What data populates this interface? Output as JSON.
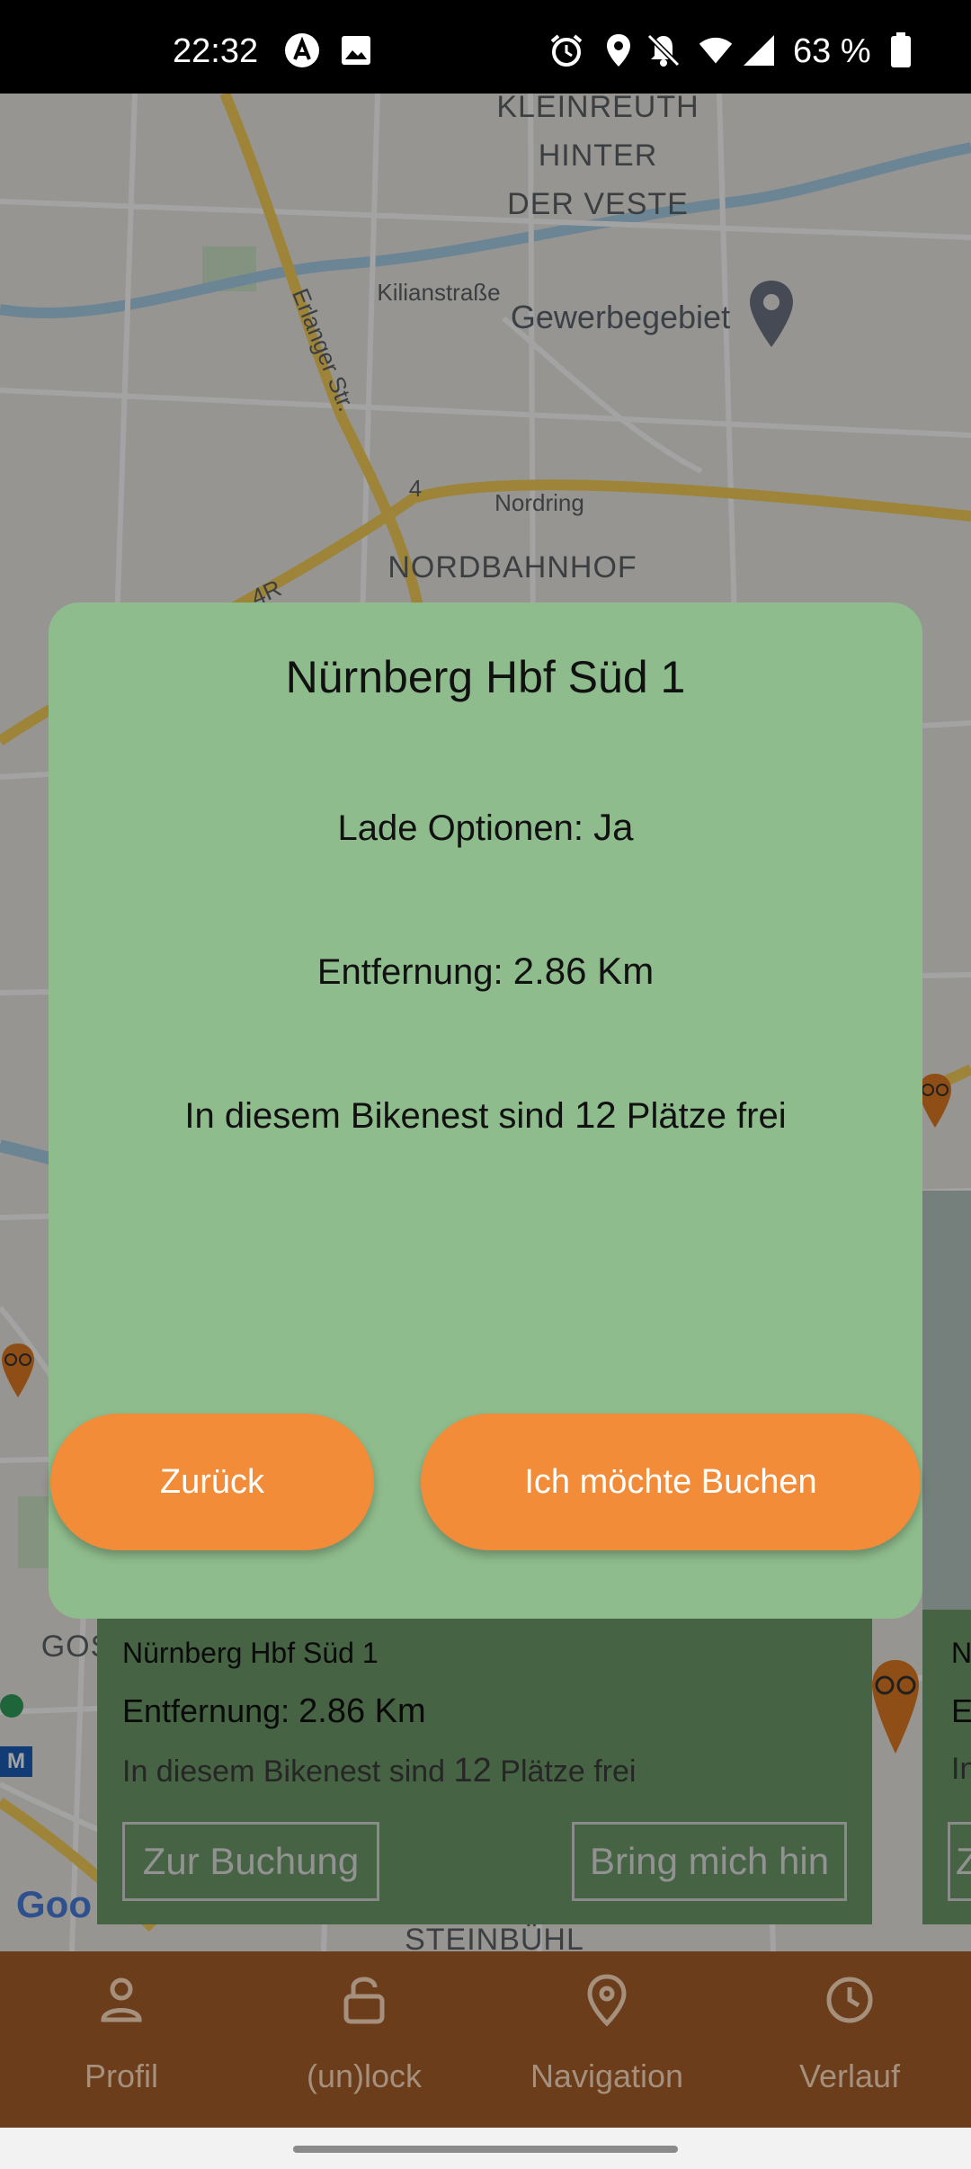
{
  "status_bar": {
    "time": "22:32",
    "battery": "63 %",
    "icons": [
      "assistant-icon",
      "gallery-icon",
      "alarm-icon",
      "location-icon",
      "notifications-off-icon",
      "wifi-icon",
      "signal-icon",
      "battery-icon"
    ]
  },
  "map": {
    "labels": {
      "district_top": "KLEINREUTH\nHINTER\nDER VESTE",
      "erlanger": "Erlanger Str.",
      "kilian": "Kilianstraße",
      "gewerbe": "Gewerbegebiet",
      "road4": "4",
      "nordring": "Nordring",
      "nordbahnhof": "NORDBAHNHOF",
      "road4r": "4R",
      "gos": "GOS",
      "steinbuehl": "STEINBÜHL",
      "google": "Goo"
    }
  },
  "info_card": {
    "title": "Nürnberg Hbf Süd 1",
    "distance_label": "Entfernung:",
    "distance_value": "2.86 Km",
    "free_prefix": "In diesem Bikenest sind",
    "free_count": "12",
    "free_suffix": "Plätze frei",
    "book_button": "Zur Buchung",
    "navigate_button": "Bring mich hin",
    "next_card_initial": "N",
    "next_card_line2": "E",
    "next_card_line3": "In",
    "next_card_button": "Z"
  },
  "dialog": {
    "title": "Nürnberg Hbf Süd 1",
    "charging_label": "Lade Optionen:",
    "charging_value": "Ja",
    "distance_label": "Entfernung:",
    "distance_value": "2.86 Km",
    "free_prefix": "In diesem Bikenest sind",
    "free_count": "12",
    "free_suffix": "Plätze frei",
    "back_button": "Zurück",
    "book_button": "Ich möchte Buchen"
  },
  "bottom_nav": {
    "items": [
      {
        "label": "Profil",
        "icon": "person-icon"
      },
      {
        "label": "(un)lock",
        "icon": "lock-icon"
      },
      {
        "label": "Navigation",
        "icon": "location-pin-icon"
      },
      {
        "label": "Verlauf",
        "icon": "clock-icon"
      }
    ]
  },
  "colors": {
    "dialog_bg": "#8fbc8c",
    "button_orange": "#f28c38",
    "nav_bg": "#6b3d1a",
    "card_bg": "#6e9c6a"
  }
}
